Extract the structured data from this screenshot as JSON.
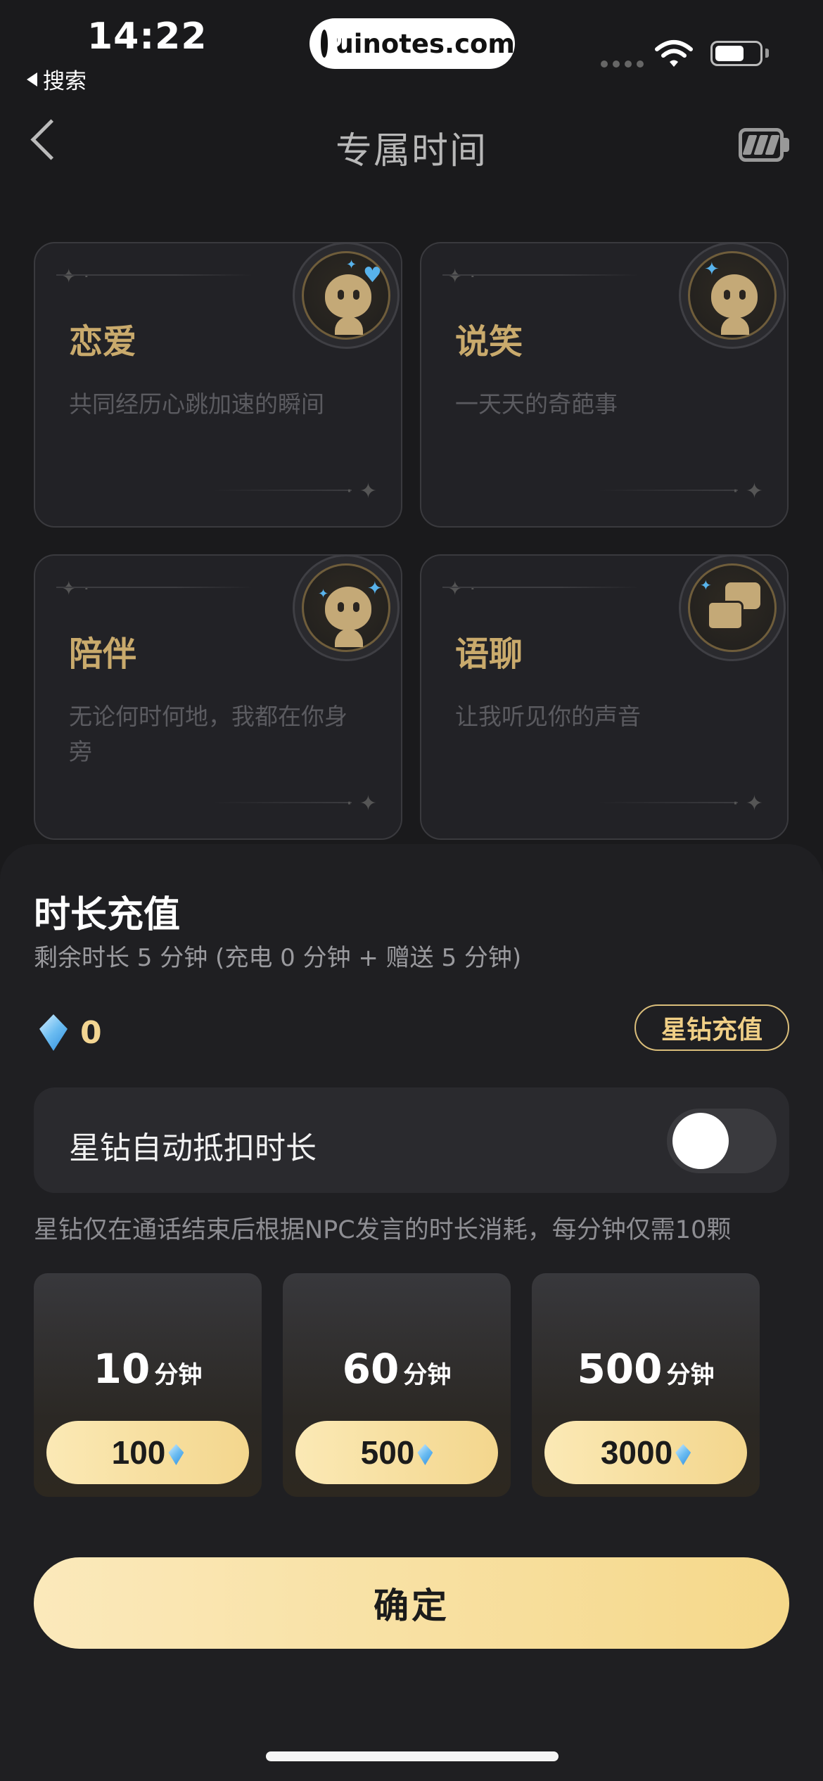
{
  "status_bar": {
    "time": "14:22",
    "back_app": "搜索",
    "url": "uinotes.com"
  },
  "nav": {
    "title": "专属时间"
  },
  "categories": [
    {
      "title": "恋爱",
      "desc": "共同经历心跳加速的瞬间",
      "icon": "love-npc-icon"
    },
    {
      "title": "说笑",
      "desc": "一天天的奇葩事",
      "icon": "laugh-npc-icon"
    },
    {
      "title": "陪伴",
      "desc": "无论何时何地，我都在你身旁",
      "icon": "companion-npc-icon"
    },
    {
      "title": "语聊",
      "desc": "让我听见你的声音",
      "icon": "voice-chat-icon"
    }
  ],
  "recharge": {
    "title": "时长充值",
    "subtitle": "剩余时长 5 分钟 (充电 0 分钟 + 赠送 5 分钟)",
    "diamond_count": "0",
    "recharge_button": "星钻充值",
    "auto_deduct_label": "星钻自动抵扣时长",
    "auto_deduct_enabled": false,
    "note": "星钻仅在通话结束后根据NPC发言的时长消耗，每分钟仅需10颗",
    "packages": [
      {
        "minutes": "10",
        "unit": "分钟",
        "price": "100"
      },
      {
        "minutes": "60",
        "unit": "分钟",
        "price": "500"
      },
      {
        "minutes": "500",
        "unit": "分钟",
        "price": "3000"
      }
    ],
    "confirm_button": "确定"
  },
  "colors": {
    "accent_gold": "#c9aa6c",
    "button_gradient_start": "#fbe9bb",
    "button_gradient_end": "#f5d88a",
    "gem_blue": "#6bbcf1"
  }
}
